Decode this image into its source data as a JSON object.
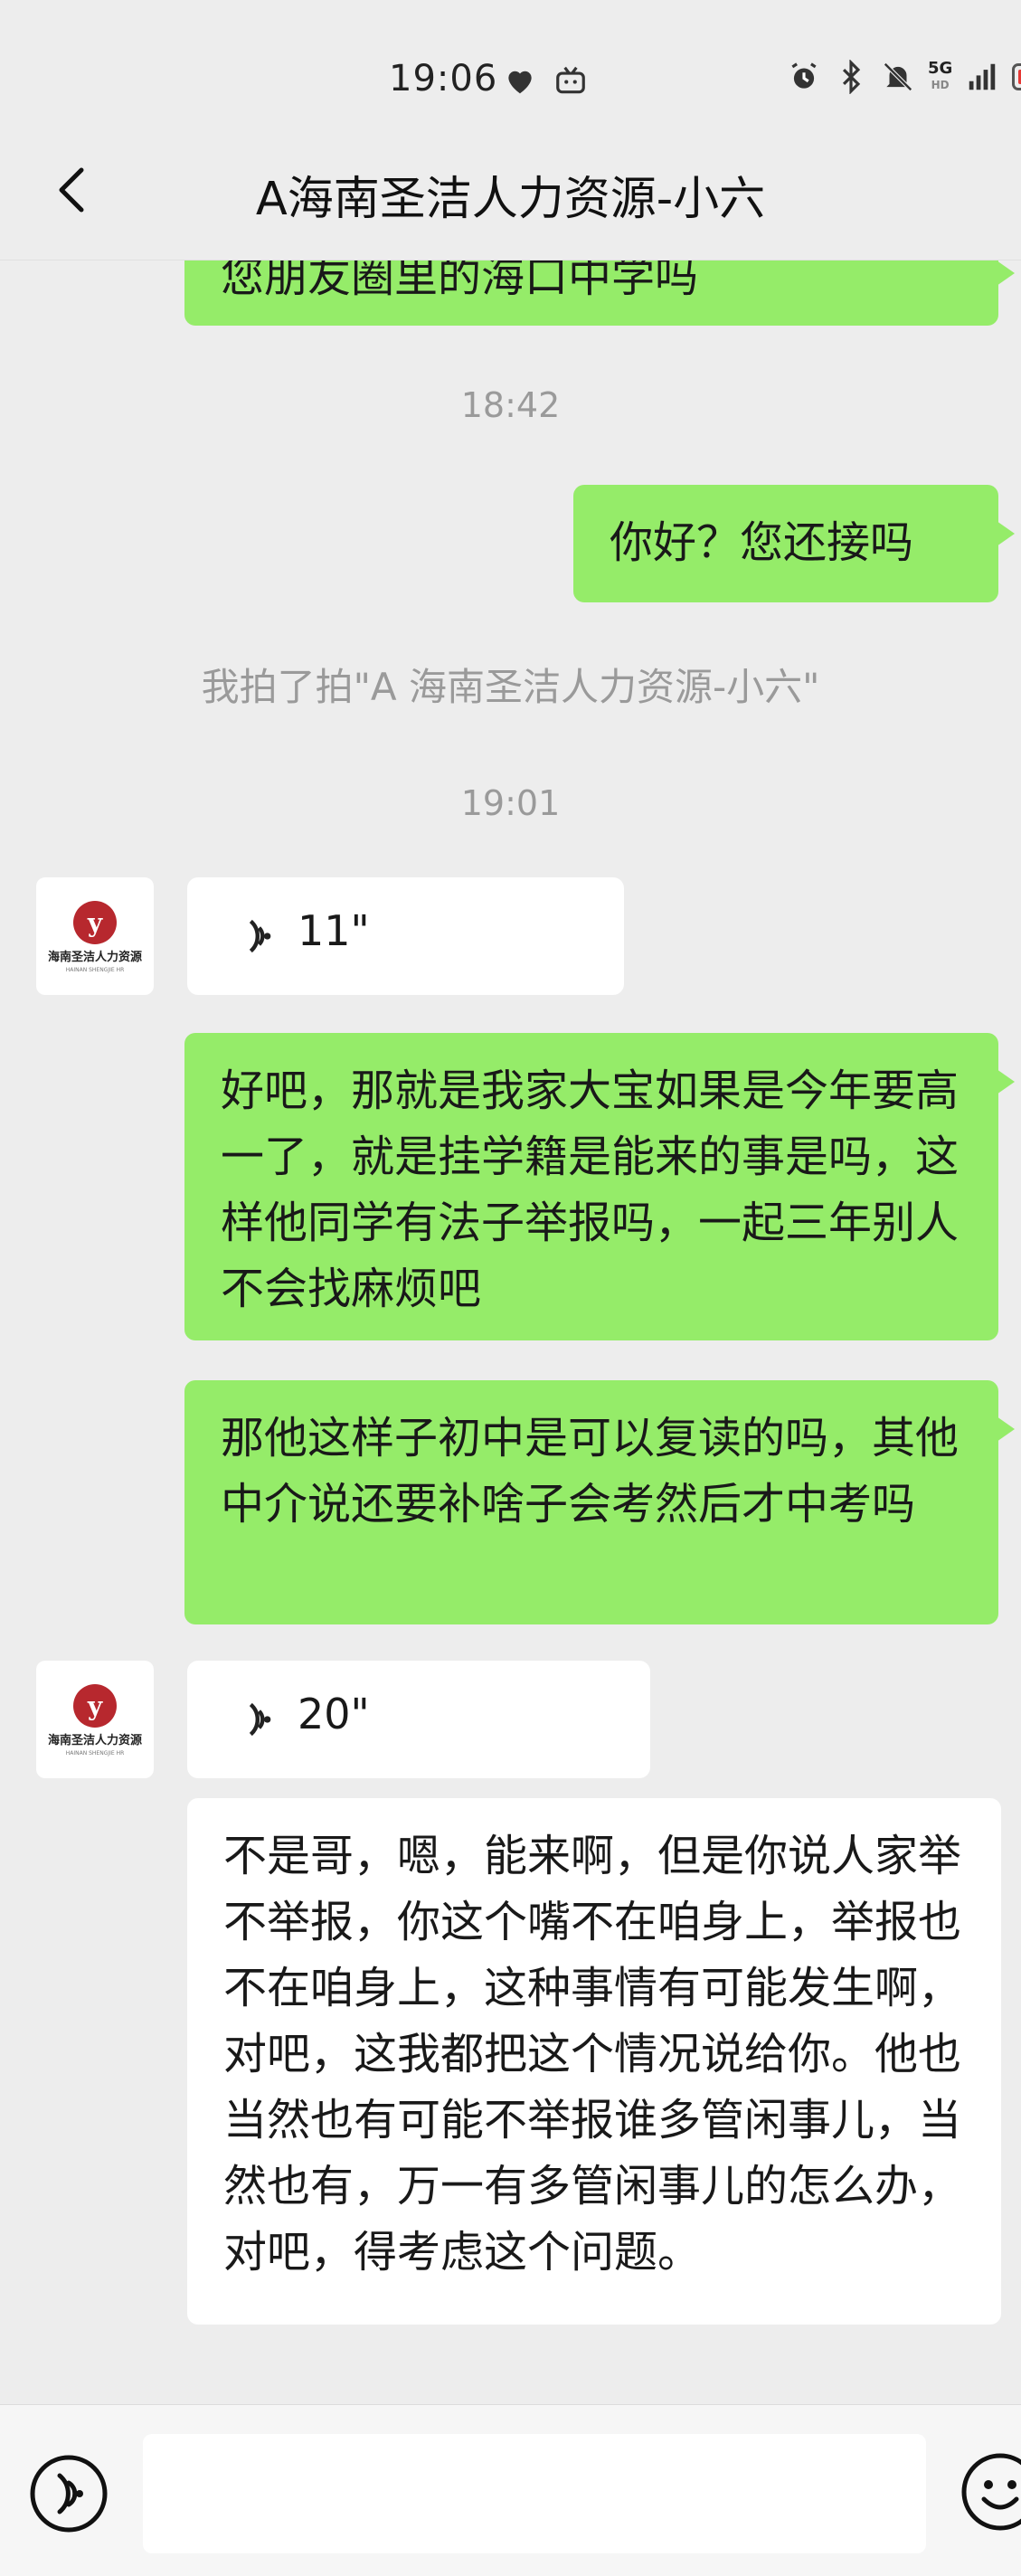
{
  "status_bar": {
    "time": "19:06",
    "network": "5G",
    "network_sub": "HD"
  },
  "header": {
    "title": "A海南圣洁人力资源-小六"
  },
  "messages": [
    {
      "type": "text",
      "side": "mine",
      "text": "您朋友圈里的海口中学吗"
    },
    {
      "type": "time",
      "text": "18:42"
    },
    {
      "type": "text",
      "side": "mine",
      "text": "你好？您还接吗"
    },
    {
      "type": "system",
      "text": "我拍了拍\"A 海南圣洁人力资源-小六\""
    },
    {
      "type": "time",
      "text": "19:01"
    },
    {
      "type": "voice",
      "side": "theirs",
      "duration": "11\""
    },
    {
      "type": "text",
      "side": "mine",
      "text": "好吧，那就是我家大宝如果是今年要高一了，就是挂学籍是能来的事是吗，这样他同学有法子举报吗，一起三年别人不会找麻烦吧"
    },
    {
      "type": "text",
      "side": "mine",
      "text": "那他这样子初中是可以复读的吗，其他中介说还要补啥子会考然后才中考吗"
    },
    {
      "type": "voice",
      "side": "theirs",
      "duration": "20\""
    },
    {
      "type": "text",
      "side": "theirs",
      "text": "不是哥，嗯，能来啊，但是你说人家举不举报，你这个嘴不在咱身上，举报也不在咱身上，这种事情有可能发生啊，对吧，这我都把这个情况说给你。他也当然也有可能不举报谁多管闲事儿，当然也有，万一有多管闲事儿的怎么办，对吧，得考虑这个问题。"
    }
  ],
  "avatar": {
    "logo_text": "海南圣洁人力资源",
    "sub_text": "HAINAN SHENGJIE HR"
  },
  "input": {
    "value": "",
    "placeholder": ""
  },
  "colors": {
    "mine_bubble": "#95ec69",
    "theirs_bubble": "#ffffff",
    "background": "#ededed"
  }
}
